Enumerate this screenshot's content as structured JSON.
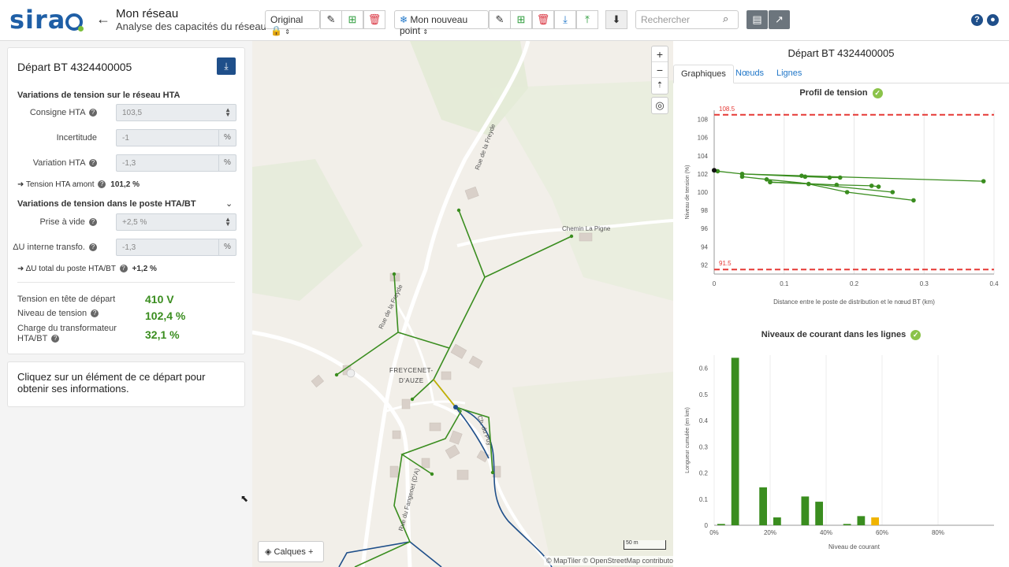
{
  "header": {
    "logo": "sirao",
    "title": "Mon réseau",
    "subtitle": "Analyse des capacités du réseau",
    "version_select": "Original",
    "point_select": "Mon nouveau point",
    "search_placeholder": "Rechercher"
  },
  "left": {
    "title": "Départ BT 4324400005",
    "hta_section": "Variations de tension sur le réseau HTA",
    "fields_hta": [
      {
        "label": "Consigne HTA",
        "value": "103,5"
      },
      {
        "label": "Incertitude",
        "value": "-1",
        "unit": "%"
      },
      {
        "label": "Variation HTA",
        "value": "-1,3",
        "unit": "%"
      }
    ],
    "tension_amont_label": "➜ Tension HTA amont",
    "tension_amont_value": "101,2 %",
    "poste_section": "Variations de tension dans le poste HTA/BT",
    "fields_poste": [
      {
        "label": "Prise à vide",
        "value": "+2,5 %"
      },
      {
        "label": "ΔU interne transfo.",
        "value": "-1,3",
        "unit": "%"
      }
    ],
    "du_total_label": "➜ ΔU total du poste HTA/BT",
    "du_total_value": "+1,2 %",
    "kpis": [
      {
        "label": "Tension en tête de départ",
        "value": "410 V"
      },
      {
        "label": "Niveau de tension",
        "value": "102,4 %"
      },
      {
        "label": "Charge du transformateur HTA/BT",
        "value": "32,1 %"
      }
    ],
    "info": "Cliquez sur un élément de ce départ pour obtenir ses informations."
  },
  "map": {
    "labels": [
      "Rue de la Freyde",
      "Chemin La Pigne",
      "Rue de la Freyde",
      "FREYCENET-",
      "D'AUZE",
      "Rue du Fangenet (D'A)",
      "Ch. du Puy"
    ],
    "calques": "Calques",
    "scale": "50 m",
    "attribution": "© MapTiler © OpenStreetMap contributors"
  },
  "right": {
    "title": "Départ BT 4324400005",
    "tabs": [
      "Graphiques",
      "Nœuds",
      "Lignes"
    ],
    "profile_title": "Profil de tension",
    "current_title": "Niveaux de courant dans les lignes"
  },
  "chart_data": [
    {
      "type": "line",
      "title": "Profil de tension",
      "xlabel": "Distance entre le poste de distribution et le nœud BT (km)",
      "ylabel": "Niveau de tension (%)",
      "xlim": [
        0,
        0.4
      ],
      "ylim": [
        91,
        109
      ],
      "xticks": [
        "0",
        "0.1",
        "0.2",
        "0.3",
        "0.4"
      ],
      "yticks": [
        "92",
        "94",
        "96",
        "98",
        "100",
        "102",
        "104",
        "106",
        "108"
      ],
      "limits": [
        {
          "label": "108.5",
          "value": 108.5
        },
        {
          "label": "91.5",
          "value": 91.5
        }
      ],
      "series": [
        {
          "values": [
            [
              0,
              102.4
            ],
            [
              0.005,
              102.3
            ],
            [
              0.04,
              102.0
            ],
            [
              0.125,
              101.8
            ],
            [
              0.385,
              101.2
            ]
          ]
        },
        {
          "values": [
            [
              0.04,
              102.0
            ],
            [
              0.13,
              101.7
            ],
            [
              0.165,
              101.6
            ],
            [
              0.18,
              101.6
            ]
          ]
        },
        {
          "values": [
            [
              0.04,
              101.7
            ],
            [
              0.075,
              101.4
            ],
            [
              0.255,
              100.0
            ]
          ]
        },
        {
          "values": [
            [
              0.08,
              101.1
            ],
            [
              0.175,
              100.8
            ],
            [
              0.225,
              100.7
            ],
            [
              0.235,
              100.6
            ]
          ]
        },
        {
          "values": [
            [
              0.08,
              101.1
            ],
            [
              0.135,
              100.9
            ],
            [
              0.19,
              100.0
            ],
            [
              0.285,
              99.1
            ]
          ]
        }
      ]
    },
    {
      "type": "bar",
      "title": "Niveaux de courant dans les lignes",
      "xlabel": "Niveau de courant",
      "ylabel": "Longueur cumulée (en km)",
      "ylim": [
        0,
        0.65
      ],
      "xticks": [
        "0%",
        "20%",
        "40%",
        "60%",
        "80%"
      ],
      "yticks": [
        "0",
        "0.1",
        "0.2",
        "0.3",
        "0.4",
        "0.5",
        "0.6"
      ],
      "x": [
        2.5,
        7.5,
        12.5,
        17.5,
        22.5,
        27.5,
        32.5,
        37.5,
        42.5,
        47.5,
        52.5,
        57.5
      ],
      "values": [
        0.005,
        0.64,
        0.0,
        0.145,
        0.03,
        0.0,
        0.11,
        0.09,
        0.0,
        0.005,
        0.035,
        0.03
      ],
      "colors": [
        "#3a8d1f",
        "#3a8d1f",
        "#3a8d1f",
        "#3a8d1f",
        "#3a8d1f",
        "#3a8d1f",
        "#3a8d1f",
        "#3a8d1f",
        "#3a8d1f",
        "#3a8d1f",
        "#3a8d1f",
        "#f0b400"
      ]
    }
  ],
  "colors": {
    "accent": "#1f4f8a",
    "green": "#3a8d1f",
    "limit": "#e53935",
    "warn": "#f0b400"
  }
}
